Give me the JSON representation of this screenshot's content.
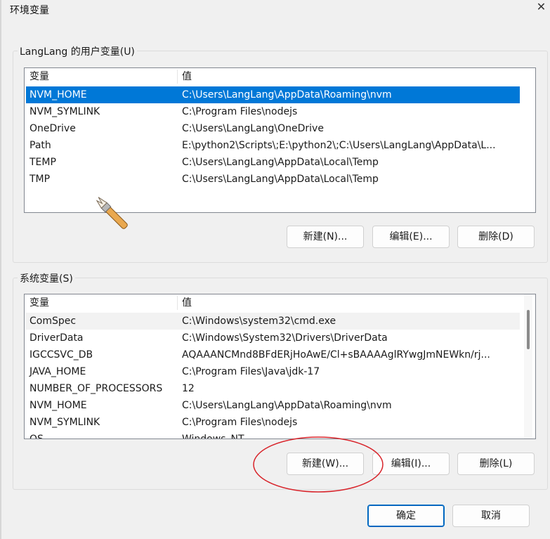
{
  "window": {
    "title": "环境变量"
  },
  "user_vars": {
    "group_label": "LangLang 的用户变量(U)",
    "columns": [
      "变量",
      "值"
    ],
    "rows": [
      {
        "name": "NVM_HOME",
        "value": "C:\\Users\\LangLang\\AppData\\Roaming\\nvm",
        "selected": true
      },
      {
        "name": "NVM_SYMLINK",
        "value": "C:\\Program Files\\nodejs"
      },
      {
        "name": "OneDrive",
        "value": "C:\\Users\\LangLang\\OneDrive"
      },
      {
        "name": "Path",
        "value": "E:\\python2\\Scripts\\;E:\\python2\\;C:\\Users\\LangLang\\AppData\\L..."
      },
      {
        "name": "TEMP",
        "value": "C:\\Users\\LangLang\\AppData\\Local\\Temp"
      },
      {
        "name": "TMP",
        "value": "C:\\Users\\LangLang\\AppData\\Local\\Temp"
      }
    ],
    "buttons": {
      "new": "新建(N)...",
      "edit": "编辑(E)...",
      "delete": "删除(D)"
    }
  },
  "system_vars": {
    "group_label": "系统变量(S)",
    "columns": [
      "变量",
      "值"
    ],
    "rows": [
      {
        "name": "ComSpec",
        "value": "C:\\Windows\\system32\\cmd.exe"
      },
      {
        "name": "DriverData",
        "value": "C:\\Windows\\System32\\Drivers\\DriverData"
      },
      {
        "name": "IGCCSVC_DB",
        "value": "AQAAANCMnd8BFdERjHoAwE/Cl+sBAAAAglRYwgJmNEWkn/rj..."
      },
      {
        "name": "JAVA_HOME",
        "value": "C:\\Program Files\\Java\\jdk-17"
      },
      {
        "name": "NUMBER_OF_PROCESSORS",
        "value": "12"
      },
      {
        "name": "NVM_HOME",
        "value": "C:\\Users\\LangLang\\AppData\\Roaming\\nvm"
      },
      {
        "name": "NVM_SYMLINK",
        "value": "C:\\Program Files\\nodejs"
      },
      {
        "name": "OS",
        "value": "Windows_NT"
      }
    ],
    "buttons": {
      "new": "新建(W)...",
      "edit": "编辑(I)...",
      "delete": "删除(L)"
    }
  },
  "dialog_buttons": {
    "ok": "确定",
    "cancel": "取消"
  },
  "annotations": {
    "highlight_color": "#d8232a",
    "highlighted_button": "system-new-button"
  }
}
